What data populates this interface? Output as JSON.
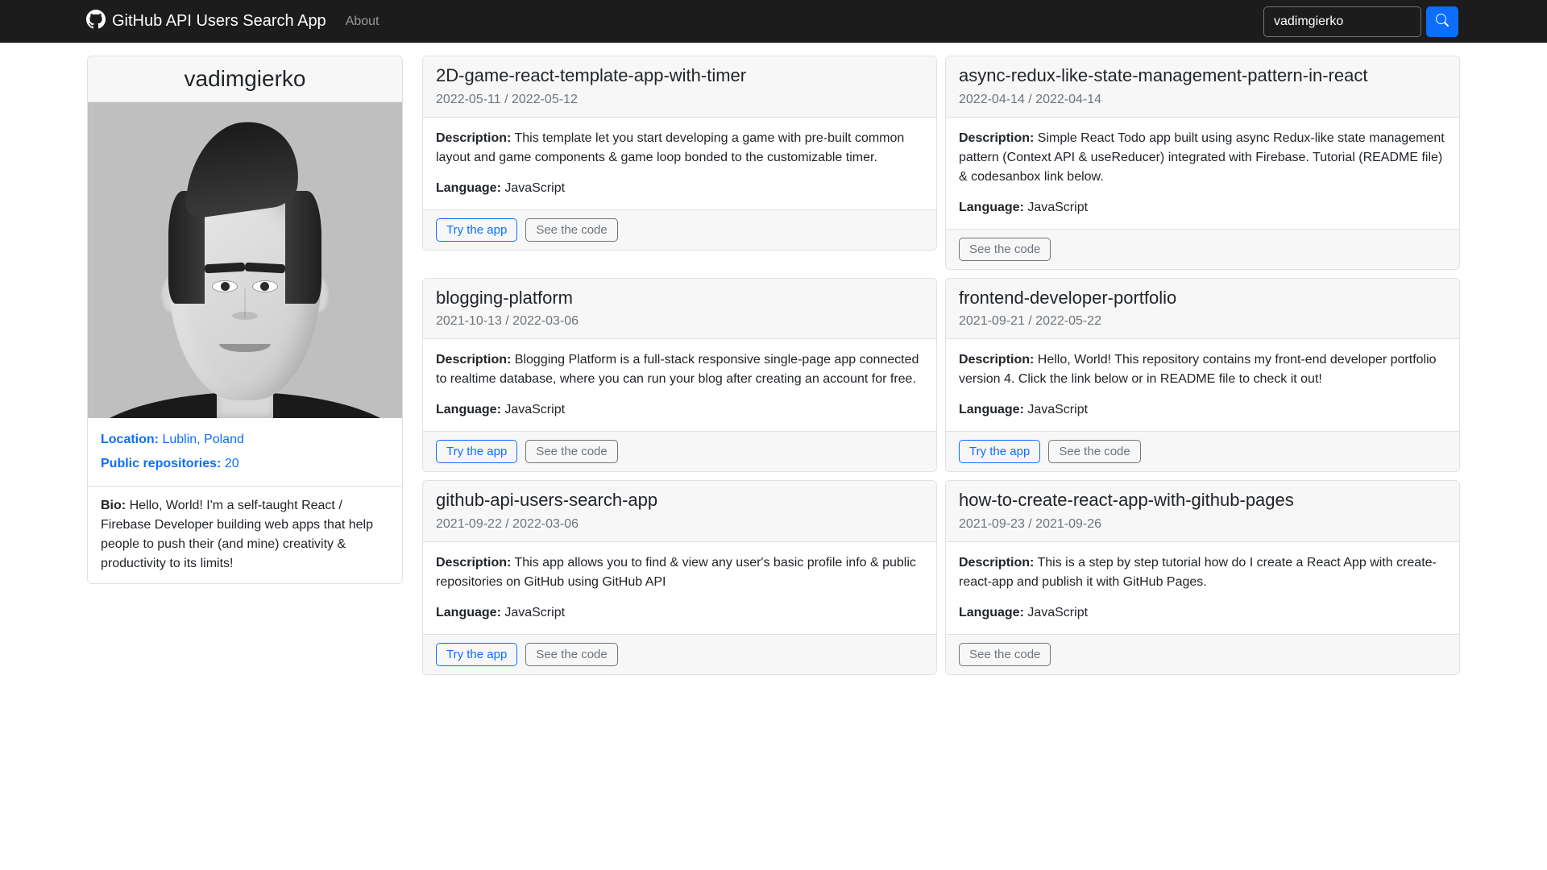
{
  "header": {
    "brand": "GitHub API Users Search App",
    "about": "About",
    "search_value": "vadimgierko"
  },
  "user": {
    "login": "vadimgierko",
    "location_label": "Location:",
    "location_value": "Lublin, Poland",
    "repos_label": "Public repositories:",
    "repos_value": "20",
    "bio_label": "Bio:",
    "bio_value": "Hello, World! I'm a self-taught React / Firebase Developer building web apps that help people to push their (and mine) creativity & productivity to its limits!"
  },
  "labels": {
    "description": "Description:",
    "language": "Language:",
    "try": "Try the app",
    "code": "See the code"
  },
  "repos": [
    {
      "name": "2D-game-react-template-app-with-timer",
      "dates": "2022-05-11 / 2022-05-12",
      "description": "This template let you start developing a game with pre-built common layout and game components & game loop bonded to the customizable timer.",
      "language": "JavaScript",
      "has_demo": true
    },
    {
      "name": "async-redux-like-state-management-pattern-in-react",
      "dates": "2022-04-14 / 2022-04-14",
      "description": "Simple React Todo app built using async Redux-like state management pattern (Context API & useReducer) integrated with Firebase. Tutorial (README file) & codesanbox link below.",
      "language": "JavaScript",
      "has_demo": false
    },
    {
      "name": "blogging-platform",
      "dates": "2021-10-13 / 2022-03-06",
      "description": "Blogging Platform is a full-stack responsive single-page app connected to realtime database, where you can run your blog after creating an account for free.",
      "language": "JavaScript",
      "has_demo": true
    },
    {
      "name": "frontend-developer-portfolio",
      "dates": "2021-09-21 / 2022-05-22",
      "description": "Hello, World! This repository contains my front-end developer portfolio version 4. Click the link below or in README file to check it out!",
      "language": "JavaScript",
      "has_demo": true
    },
    {
      "name": "github-api-users-search-app",
      "dates": "2021-09-22 / 2022-03-06",
      "description": "This app allows you to find & view any user's basic profile info & public repositories on GitHub using GitHub API",
      "language": "JavaScript",
      "has_demo": true
    },
    {
      "name": "how-to-create-react-app-with-github-pages",
      "dates": "2021-09-23 / 2021-09-26",
      "description": "This is a step by step tutorial how do I create a React App with create-react-app and publish it with GitHub Pages.",
      "language": "JavaScript",
      "has_demo": false
    }
  ]
}
